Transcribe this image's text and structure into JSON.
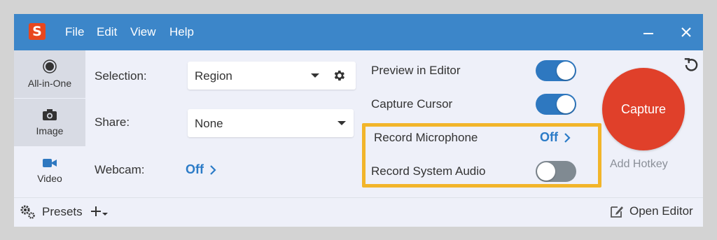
{
  "menu": [
    "File",
    "Edit",
    "View",
    "Help"
  ],
  "logo_letter": "S",
  "modes": [
    {
      "label": "All-in-One",
      "icon": "all-in-one-icon"
    },
    {
      "label": "Image",
      "icon": "camera-icon"
    },
    {
      "label": "Video",
      "icon": "video-camera-icon"
    }
  ],
  "selection": {
    "label": "Selection:",
    "value": "Region"
  },
  "share": {
    "label": "Share:",
    "value": "None"
  },
  "webcam": {
    "label": "Webcam:",
    "value": "Off"
  },
  "options": {
    "preview_in_editor": {
      "label": "Preview in Editor",
      "state": "on"
    },
    "capture_cursor": {
      "label": "Capture Cursor",
      "state": "on"
    },
    "record_microphone": {
      "label": "Record Microphone",
      "value": "Off"
    },
    "record_system_audio": {
      "label": "Record System Audio",
      "state": "off"
    }
  },
  "capture": {
    "label": "Capture",
    "hotkey_label": "Add Hotkey"
  },
  "footer": {
    "presets_label": "Presets",
    "open_editor_label": "Open Editor"
  },
  "colors": {
    "titlebar": "#3c86c9",
    "accent": "#2e78c0",
    "capture": "#e0402a",
    "highlight": "#f2b52a"
  }
}
